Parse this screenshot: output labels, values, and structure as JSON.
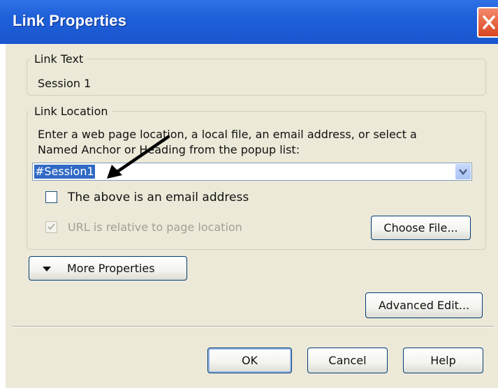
{
  "window": {
    "title": "Link Properties"
  },
  "link_text": {
    "legend": "Link Text",
    "value": "Session 1"
  },
  "link_location": {
    "legend": "Link Location",
    "instruction_line1": "Enter a web page location, a local file, an email address, or select a",
    "instruction_line2": "Named Anchor or Heading from the popup list:",
    "url_value": "#Session1",
    "email_checkbox_label": "The above is an email address",
    "email_checkbox_checked": false,
    "relative_checkbox_label": "URL is relative to page location",
    "relative_checkbox_checked": true,
    "choose_file_label": "Choose File..."
  },
  "more_properties_label": "More Properties",
  "advanced_edit_label": "Advanced Edit...",
  "buttons": {
    "ok": "OK",
    "cancel": "Cancel",
    "help": "Help"
  },
  "colors": {
    "titlebar": "#1e5fd8",
    "dialog_bg": "#ece9d8",
    "selection": "#316ac5"
  }
}
